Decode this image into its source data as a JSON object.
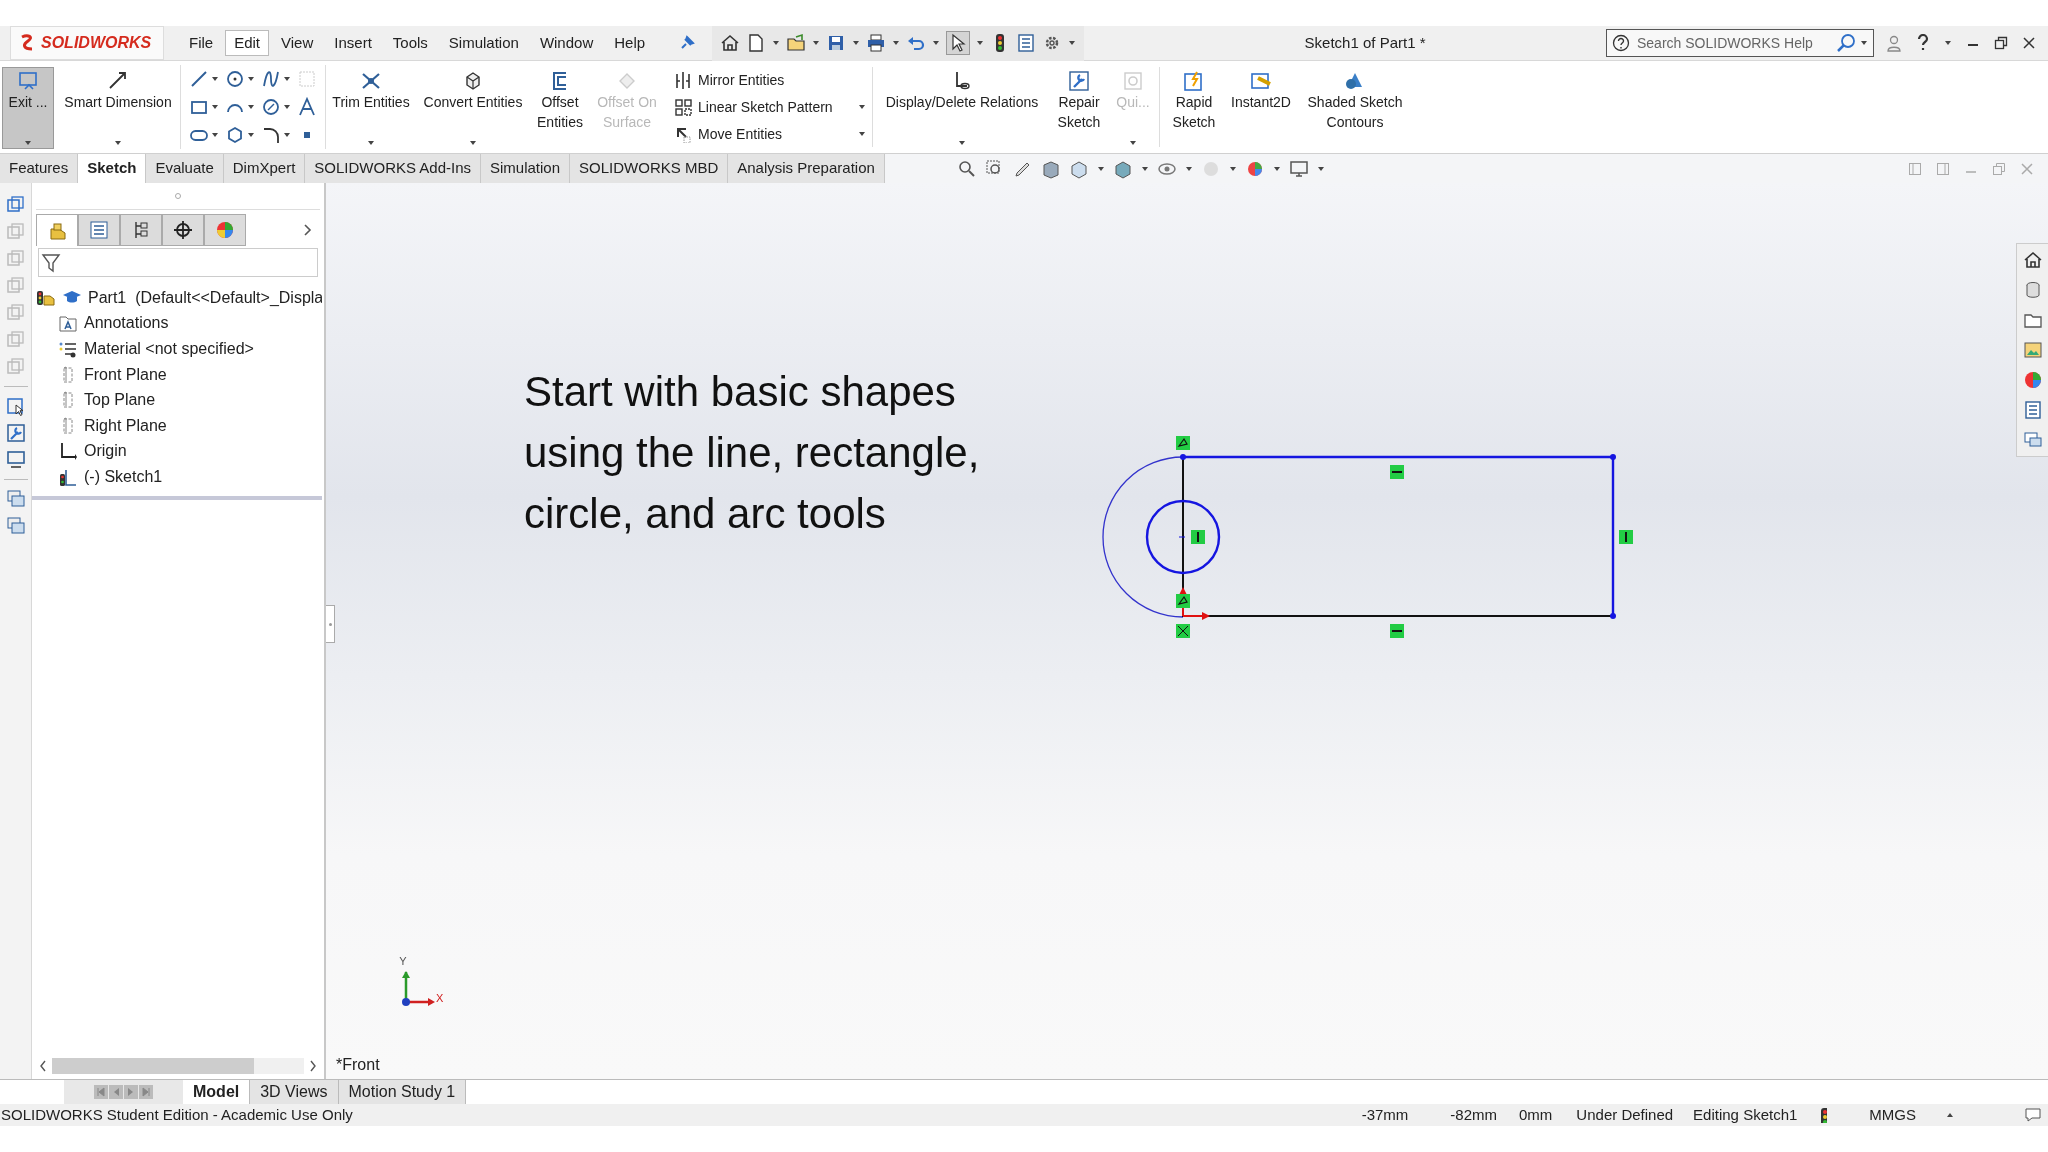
{
  "app": {
    "logo": "SOLIDWORKS",
    "title": "Sketch1 of Part1 *",
    "search": {
      "placeholder": "Search SOLIDWORKS Help"
    }
  },
  "menu": [
    {
      "label": "File",
      "selected": false
    },
    {
      "label": "Edit",
      "selected": true
    },
    {
      "label": "View",
      "selected": false
    },
    {
      "label": "Insert",
      "selected": false
    },
    {
      "label": "Tools",
      "selected": false
    },
    {
      "label": "Simulation",
      "selected": false
    },
    {
      "label": "Window",
      "selected": false
    },
    {
      "label": "Help",
      "selected": false
    }
  ],
  "ribbon": [
    {
      "kind": "large",
      "label": "Exit ...",
      "selected": true,
      "disabled": false
    },
    {
      "kind": "large",
      "label": "Smart Dimension",
      "selected": false,
      "disabled": false
    },
    {
      "kind": "tools"
    },
    {
      "kind": "large",
      "label": "Trim Entities",
      "selected": false,
      "disabled": false
    },
    {
      "kind": "large",
      "label": "Convert Entities",
      "selected": false,
      "disabled": false
    },
    {
      "kind": "large",
      "label": "Offset Entities",
      "selected": false,
      "disabled": false
    },
    {
      "kind": "large",
      "label": "Offset On Surface",
      "selected": false,
      "disabled": true
    },
    {
      "kind": "stack",
      "items": [
        {
          "label": "Mirror Entities"
        },
        {
          "label": "Linear Sketch Pattern"
        },
        {
          "label": "Move Entities"
        }
      ]
    },
    {
      "kind": "large",
      "label": "Display/Delete Relations",
      "selected": false,
      "disabled": false
    },
    {
      "kind": "large",
      "label": "Repair Sketch",
      "selected": false,
      "disabled": false
    },
    {
      "kind": "large",
      "label": "Qui...",
      "selected": false,
      "disabled": true
    },
    {
      "kind": "large",
      "label": "Rapid Sketch",
      "selected": false,
      "disabled": false
    },
    {
      "kind": "large",
      "label": "Instant2D",
      "selected": false,
      "disabled": false
    },
    {
      "kind": "large",
      "label": "Shaded Sketch Contours",
      "selected": false,
      "disabled": false
    }
  ],
  "panel_tabs": [
    {
      "selected": true
    },
    {
      "selected": false
    },
    {
      "selected": false
    },
    {
      "selected": false
    },
    {
      "selected": false
    }
  ],
  "command_tabs": [
    {
      "label": "Features",
      "selected": false
    },
    {
      "label": "Sketch",
      "selected": true
    },
    {
      "label": "Evaluate",
      "selected": false
    },
    {
      "label": "DimXpert",
      "selected": false
    },
    {
      "label": "SOLIDWORKS Add-Ins",
      "selected": false
    },
    {
      "label": "Simulation",
      "selected": false
    },
    {
      "label": "SOLIDWORKS MBD",
      "selected": false
    },
    {
      "label": "Analysis Preparation",
      "selected": false
    }
  ],
  "feature_tree": {
    "root": {
      "label": "Part1  (Default<<Default>_Displa",
      "kind": "part",
      "children": [
        {
          "label": "Annotations",
          "kind": "annotations"
        },
        {
          "label": "Material <not specified>",
          "kind": "material"
        },
        {
          "label": "Front Plane",
          "kind": "plane"
        },
        {
          "label": "Top Plane",
          "kind": "plane"
        },
        {
          "label": "Right Plane",
          "kind": "plane"
        },
        {
          "label": "Origin",
          "kind": "origin"
        },
        {
          "label": "(-) Sketch1",
          "kind": "sketch"
        }
      ]
    }
  },
  "canvas": {
    "caption": "Start with basic shapes using the line, rectangle, circle, and arc tools",
    "view_name": "*Front",
    "triad": {
      "y": "Y",
      "x": "X"
    }
  },
  "bottom_tabs": [
    {
      "label": "Model",
      "selected": true
    },
    {
      "label": "3D Views",
      "selected": false
    },
    {
      "label": "Motion Study 1",
      "selected": false
    }
  ],
  "status_bar": {
    "edition": "SOLIDWORKS Student Edition - Academic Use Only",
    "fields": [
      "-37mm",
      "-82mm",
      "0mm",
      "Under Defined",
      "Editing Sketch1"
    ],
    "units": "MMGS"
  }
}
